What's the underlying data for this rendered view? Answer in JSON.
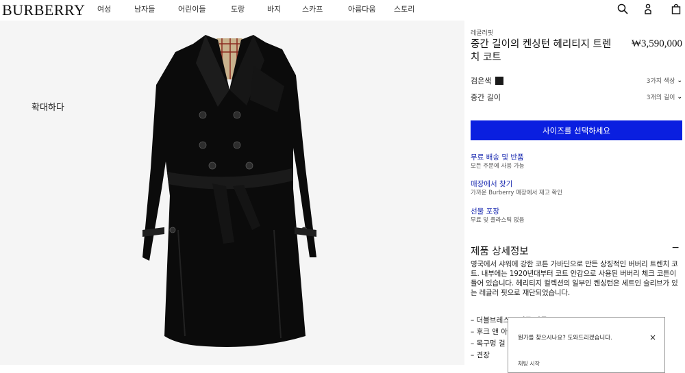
{
  "header": {
    "logo": "BURBERRY",
    "nav": [
      "여성",
      "남자들",
      "어린이들",
      "도랑",
      "바지",
      "스카프",
      "아름다움",
      "스토리"
    ]
  },
  "gallery": {
    "zoom_label": "확대하다"
  },
  "product": {
    "fit_label": "레귤러핏",
    "title": "중간 길이의 켄싱턴 헤리티지 트렌치 코트",
    "price": "₩3,590,000",
    "color": {
      "label": "검은색",
      "swatch": "#1a1a1a",
      "more": "3가지 색상"
    },
    "length": {
      "label": "중간 길이",
      "more": "3개의 길이"
    },
    "cta": "사이즈를 선택하세요",
    "services": [
      {
        "link": "무료 배송 및 반품",
        "sub": "모든 주문에 사용 가능"
      },
      {
        "link": "매장에서 찾기",
        "sub": "가까운 Burberry 매장에서 재고 확인"
      },
      {
        "link": "선물 포장",
        "sub": "무료 및 플라스틱 없음"
      }
    ],
    "details_title": "제품 상세정보",
    "collapse_symbol": "−",
    "description": "영국에서 샤워에 강한 코튼 가바딘으로 만든 상징적인 버버리 트렌치 코트. 내부에는 1920년대부터 코트 안감으로 사용된 버버리 체크 코튼이 들어 있습니다. 헤리티지 컬렉션의 일부인 켄싱턴은 세트인 슬리브가 있는 레귤러 핏으로 재단되었습니다.",
    "bullets": [
      "– 더블브레스트 버튼 잠금",
      "– 후크 앤 아이",
      "– 목구멍 걸",
      "– 견장"
    ]
  },
  "chat": {
    "message": "뭔가를 찾으시나요? 도와드리겠습니다.",
    "close": "×",
    "start": "채팅 시작"
  },
  "colors": {
    "accent": "#0a1fe0",
    "link": "#1a2ab0"
  }
}
